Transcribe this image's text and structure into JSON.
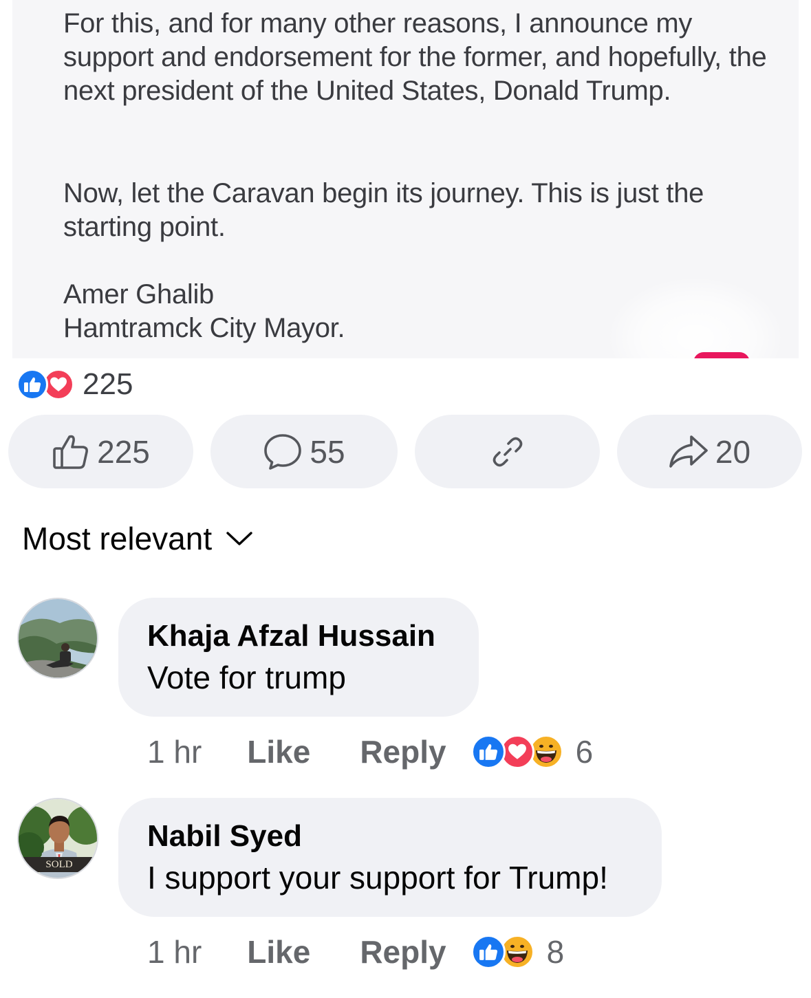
{
  "post": {
    "image_text": {
      "paragraph1": "For this, and for many other reasons, I announce my support and endorsement for the former,  and hopefully, the next president of the United States, Donald Trump.",
      "paragraph2": "Now, let the Caravan begin its journey. This is just the starting point.",
      "signature_name": "Amer Ghalib",
      "signature_title": "Hamtramck City Mayor."
    },
    "reactions": {
      "icons": [
        "like-icon",
        "love-icon"
      ],
      "count": "225"
    },
    "actions": {
      "like_count": "225",
      "comment_count": "55",
      "share_count": "20"
    }
  },
  "comments_sort": {
    "label": "Most relevant"
  },
  "comments": [
    {
      "author": "Khaja Afzal Hussain",
      "text": "Vote for trump",
      "time": "1 hr",
      "like_label": "Like",
      "reply_label": "Reply",
      "reactions": [
        "like-icon",
        "love-icon",
        "haha-icon"
      ],
      "reaction_count": "6"
    },
    {
      "author": "Nabil Syed",
      "text": "I support your support for Trump!",
      "time": "1 hr",
      "like_label": "Like",
      "reply_label": "Reply",
      "reactions": [
        "like-icon",
        "haha-icon"
      ],
      "reaction_count": "8",
      "avatar_sign_text": "SOLD"
    }
  ],
  "colors": {
    "like_blue": "#1877f2",
    "love_red": "#f33e58",
    "haha_yellow": "#f7b125",
    "pill_bg": "#f0f1f5",
    "meta_gray": "#65676b"
  }
}
